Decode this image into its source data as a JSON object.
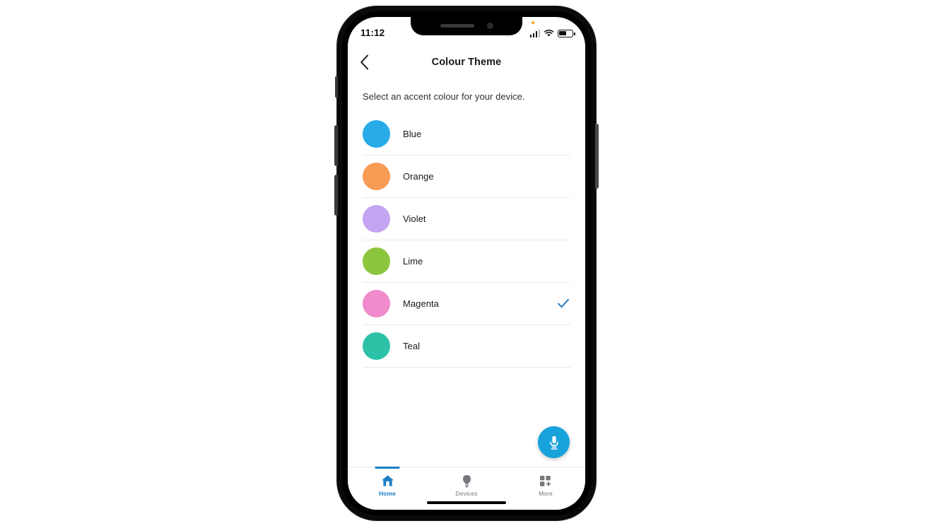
{
  "status_bar": {
    "time": "11:12",
    "signal_icon": "cellular-signal-icon",
    "wifi_icon": "wifi-icon",
    "battery_icon": "battery-icon",
    "notification_dot": "orange-notification-dot"
  },
  "nav": {
    "back_icon": "chevron-left-icon",
    "title": "Colour Theme"
  },
  "main": {
    "subtitle": "Select an accent colour for your device.",
    "selected_colour": "Magenta",
    "check_icon": "check-icon",
    "check_colour": "#2B7BBF",
    "options": [
      {
        "label": "Blue",
        "hex": "#29ABE8",
        "selected": false
      },
      {
        "label": "Orange",
        "hex": "#F89B55",
        "selected": false
      },
      {
        "label": "Violet",
        "hex": "#C3A5F2",
        "selected": false
      },
      {
        "label": "Lime",
        "hex": "#8CC63F",
        "selected": false
      },
      {
        "label": "Magenta",
        "hex": "#EF8ACB",
        "selected": true
      },
      {
        "label": "Teal",
        "hex": "#2DC1A8",
        "selected": false
      }
    ]
  },
  "fab": {
    "icon": "microphone-icon",
    "colour": "#17A2DC"
  },
  "tabbar": {
    "active": "Home",
    "accent": "#1B7FC4",
    "items": [
      {
        "label": "Home",
        "icon": "home-icon",
        "active": true
      },
      {
        "label": "Devices",
        "icon": "lightbulb-icon",
        "active": false
      },
      {
        "label": "More",
        "icon": "grid-plus-icon",
        "active": false
      }
    ]
  }
}
